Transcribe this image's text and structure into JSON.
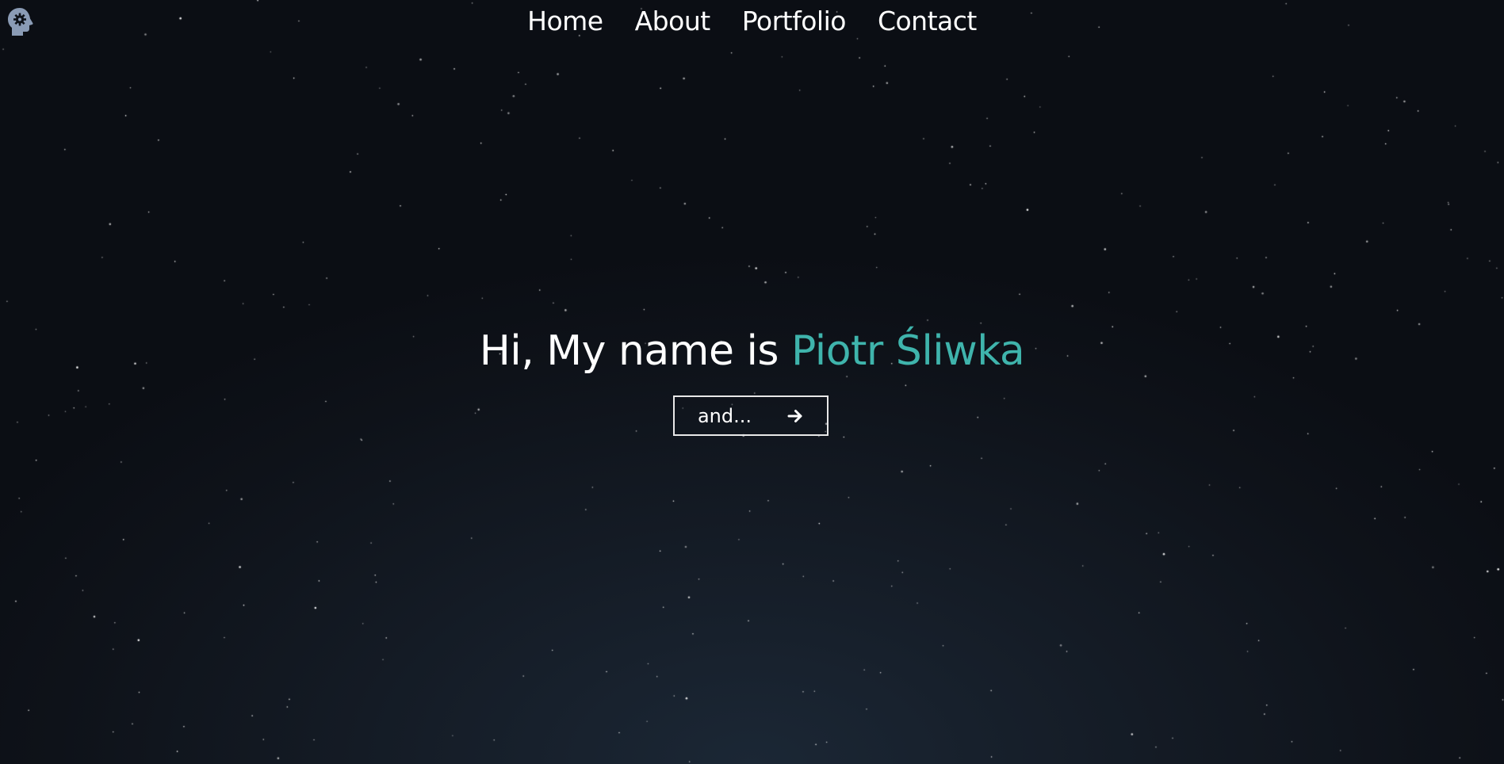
{
  "colors": {
    "accent": "#3fb4ac",
    "text": "#ffffff",
    "background": "#0e1219",
    "logo": "#8a9bb5"
  },
  "header": {
    "logo_icon": "head-gear-icon",
    "nav": [
      {
        "label": "Home"
      },
      {
        "label": "About"
      },
      {
        "label": "Portfolio"
      },
      {
        "label": "Contact"
      }
    ]
  },
  "hero": {
    "greeting": "Hi, My name is ",
    "name": "Piotr Śliwka",
    "button_label": "and...",
    "button_icon": "arrow-right-icon"
  }
}
